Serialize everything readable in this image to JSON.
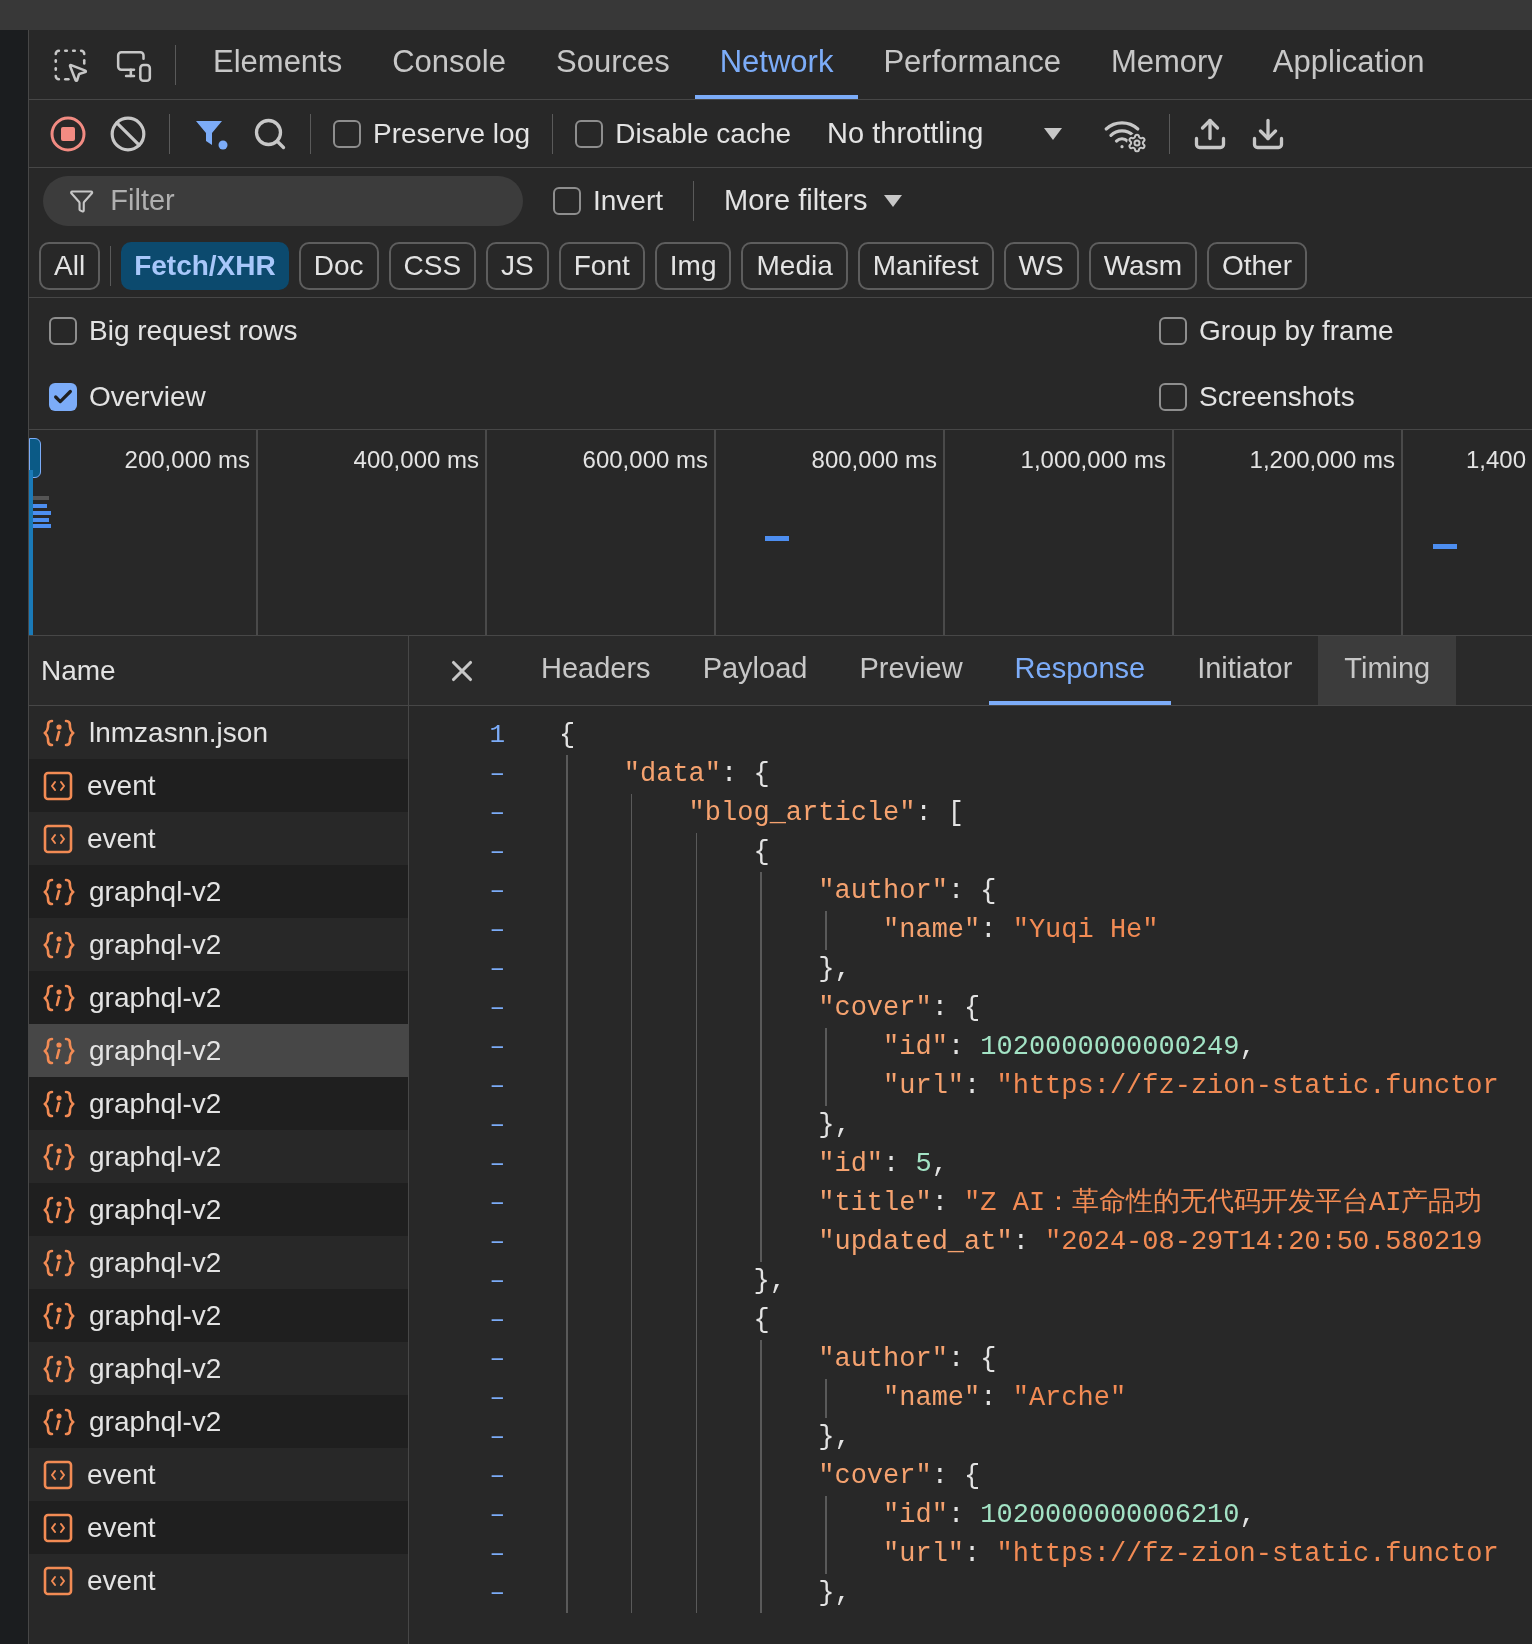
{
  "top_tabs": [
    {
      "label": "Elements",
      "selected": false
    },
    {
      "label": "Console",
      "selected": false
    },
    {
      "label": "Sources",
      "selected": false
    },
    {
      "label": "Network",
      "selected": true
    },
    {
      "label": "Performance",
      "selected": false
    },
    {
      "label": "Memory",
      "selected": false
    },
    {
      "label": "Application",
      "selected": false
    }
  ],
  "toolbar": {
    "preserve_log": {
      "label": "Preserve log",
      "checked": false
    },
    "disable_cache": {
      "label": "Disable cache",
      "checked": false
    },
    "throttling": "No throttling"
  },
  "filter": {
    "placeholder": "Filter",
    "invert": {
      "label": "Invert",
      "checked": false
    },
    "more_filters": "More filters"
  },
  "type_chips": [
    {
      "label": "All",
      "selected": false
    },
    {
      "label": "Fetch/XHR",
      "selected": true
    },
    {
      "label": "Doc",
      "selected": false
    },
    {
      "label": "CSS",
      "selected": false
    },
    {
      "label": "JS",
      "selected": false
    },
    {
      "label": "Font",
      "selected": false
    },
    {
      "label": "Img",
      "selected": false
    },
    {
      "label": "Media",
      "selected": false
    },
    {
      "label": "Manifest",
      "selected": false
    },
    {
      "label": "WS",
      "selected": false
    },
    {
      "label": "Wasm",
      "selected": false
    },
    {
      "label": "Other",
      "selected": false
    }
  ],
  "settings": [
    {
      "label": "Big request rows",
      "checked": false
    },
    {
      "label": "Group by frame",
      "checked": false
    },
    {
      "label": "Overview",
      "checked": true
    },
    {
      "label": "Screenshots",
      "checked": false
    }
  ],
  "overview": {
    "ticks": [
      "200,000 ms",
      "400,000 ms",
      "600,000 ms",
      "800,000 ms",
      "1,000,000 ms",
      "1,200,000 ms",
      "1,400"
    ]
  },
  "requests": {
    "column": "Name",
    "rows": [
      {
        "name": "lnmzasnn.json",
        "kind": "json",
        "selected": false
      },
      {
        "name": "event",
        "kind": "doc",
        "selected": false
      },
      {
        "name": "event",
        "kind": "doc",
        "selected": false
      },
      {
        "name": "graphql-v2",
        "kind": "json",
        "selected": false
      },
      {
        "name": "graphql-v2",
        "kind": "json",
        "selected": false
      },
      {
        "name": "graphql-v2",
        "kind": "json",
        "selected": false
      },
      {
        "name": "graphql-v2",
        "kind": "json",
        "selected": true
      },
      {
        "name": "graphql-v2",
        "kind": "json",
        "selected": false
      },
      {
        "name": "graphql-v2",
        "kind": "json",
        "selected": false
      },
      {
        "name": "graphql-v2",
        "kind": "json",
        "selected": false
      },
      {
        "name": "graphql-v2",
        "kind": "json",
        "selected": false
      },
      {
        "name": "graphql-v2",
        "kind": "json",
        "selected": false
      },
      {
        "name": "graphql-v2",
        "kind": "json",
        "selected": false
      },
      {
        "name": "graphql-v2",
        "kind": "json",
        "selected": false
      },
      {
        "name": "event",
        "kind": "doc",
        "selected": false
      },
      {
        "name": "event",
        "kind": "doc",
        "selected": false
      },
      {
        "name": "event",
        "kind": "doc",
        "selected": false
      }
    ]
  },
  "detail": {
    "tabs": [
      {
        "label": "Headers",
        "selected": false,
        "hovered": false
      },
      {
        "label": "Payload",
        "selected": false,
        "hovered": false
      },
      {
        "label": "Preview",
        "selected": false,
        "hovered": false
      },
      {
        "label": "Response",
        "selected": true,
        "hovered": false
      },
      {
        "label": "Initiator",
        "selected": false,
        "hovered": false
      },
      {
        "label": "Timing",
        "selected": false,
        "hovered": true
      }
    ],
    "code_lines": [
      {
        "gutter": "1",
        "parts": [
          {
            "kind": "punct",
            "text": "{"
          }
        ]
      },
      {
        "gutter": "–",
        "parts": [
          {
            "kind": "key",
            "text": "    \"data\""
          },
          {
            "kind": "punct",
            "text": ": {"
          }
        ]
      },
      {
        "gutter": "–",
        "parts": [
          {
            "kind": "key",
            "text": "        \"blog_article\""
          },
          {
            "kind": "punct",
            "text": ": ["
          }
        ]
      },
      {
        "gutter": "–",
        "parts": [
          {
            "kind": "punct",
            "text": "            {"
          }
        ]
      },
      {
        "gutter": "–",
        "parts": [
          {
            "kind": "key",
            "text": "                \"author\""
          },
          {
            "kind": "punct",
            "text": ": {"
          }
        ]
      },
      {
        "gutter": "–",
        "parts": [
          {
            "kind": "key",
            "text": "                    \"name\""
          },
          {
            "kind": "punct",
            "text": ": "
          },
          {
            "kind": "string",
            "text": "\"Yuqi He\""
          }
        ]
      },
      {
        "gutter": "–",
        "parts": [
          {
            "kind": "punct",
            "text": "                },"
          }
        ]
      },
      {
        "gutter": "–",
        "parts": [
          {
            "kind": "key",
            "text": "                \"cover\""
          },
          {
            "kind": "punct",
            "text": ": {"
          }
        ]
      },
      {
        "gutter": "–",
        "parts": [
          {
            "kind": "key",
            "text": "                    \"id\""
          },
          {
            "kind": "punct",
            "text": ": "
          },
          {
            "kind": "number",
            "text": "1020000000000249"
          },
          {
            "kind": "punct",
            "text": ","
          }
        ]
      },
      {
        "gutter": "–",
        "parts": [
          {
            "kind": "key",
            "text": "                    \"url\""
          },
          {
            "kind": "punct",
            "text": ": "
          },
          {
            "kind": "string",
            "text": "\"https://fz-zion-static.functor"
          }
        ]
      },
      {
        "gutter": "–",
        "parts": [
          {
            "kind": "punct",
            "text": "                },"
          }
        ]
      },
      {
        "gutter": "–",
        "parts": [
          {
            "kind": "key",
            "text": "                \"id\""
          },
          {
            "kind": "punct",
            "text": ": "
          },
          {
            "kind": "number",
            "text": "5"
          },
          {
            "kind": "punct",
            "text": ","
          }
        ]
      },
      {
        "gutter": "–",
        "parts": [
          {
            "kind": "key",
            "text": "                \"title\""
          },
          {
            "kind": "punct",
            "text": ": "
          },
          {
            "kind": "string",
            "text": "\"Z AI：革命性的无代码开发平台AI产品功"
          }
        ]
      },
      {
        "gutter": "–",
        "parts": [
          {
            "kind": "key",
            "text": "                \"updated_at\""
          },
          {
            "kind": "punct",
            "text": ": "
          },
          {
            "kind": "string",
            "text": "\"2024-08-29T14:20:50.580219"
          }
        ]
      },
      {
        "gutter": "–",
        "parts": [
          {
            "kind": "punct",
            "text": "            },"
          }
        ]
      },
      {
        "gutter": "–",
        "parts": [
          {
            "kind": "punct",
            "text": "            {"
          }
        ]
      },
      {
        "gutter": "–",
        "parts": [
          {
            "kind": "key",
            "text": "                \"author\""
          },
          {
            "kind": "punct",
            "text": ": {"
          }
        ]
      },
      {
        "gutter": "–",
        "parts": [
          {
            "kind": "key",
            "text": "                    \"name\""
          },
          {
            "kind": "punct",
            "text": ": "
          },
          {
            "kind": "string",
            "text": "\"Arche\""
          }
        ]
      },
      {
        "gutter": "–",
        "parts": [
          {
            "kind": "punct",
            "text": "                },"
          }
        ]
      },
      {
        "gutter": "–",
        "parts": [
          {
            "kind": "key",
            "text": "                \"cover\""
          },
          {
            "kind": "punct",
            "text": ": {"
          }
        ]
      },
      {
        "gutter": "–",
        "parts": [
          {
            "kind": "key",
            "text": "                    \"id\""
          },
          {
            "kind": "punct",
            "text": ": "
          },
          {
            "kind": "number",
            "text": "1020000000006210"
          },
          {
            "kind": "punct",
            "text": ","
          }
        ]
      },
      {
        "gutter": "–",
        "parts": [
          {
            "kind": "key",
            "text": "                    \"url\""
          },
          {
            "kind": "punct",
            "text": ": "
          },
          {
            "kind": "string",
            "text": "\"https://fz-zion-static.functor"
          }
        ]
      },
      {
        "gutter": "–",
        "parts": [
          {
            "kind": "punct",
            "text": "                },"
          }
        ]
      }
    ]
  }
}
